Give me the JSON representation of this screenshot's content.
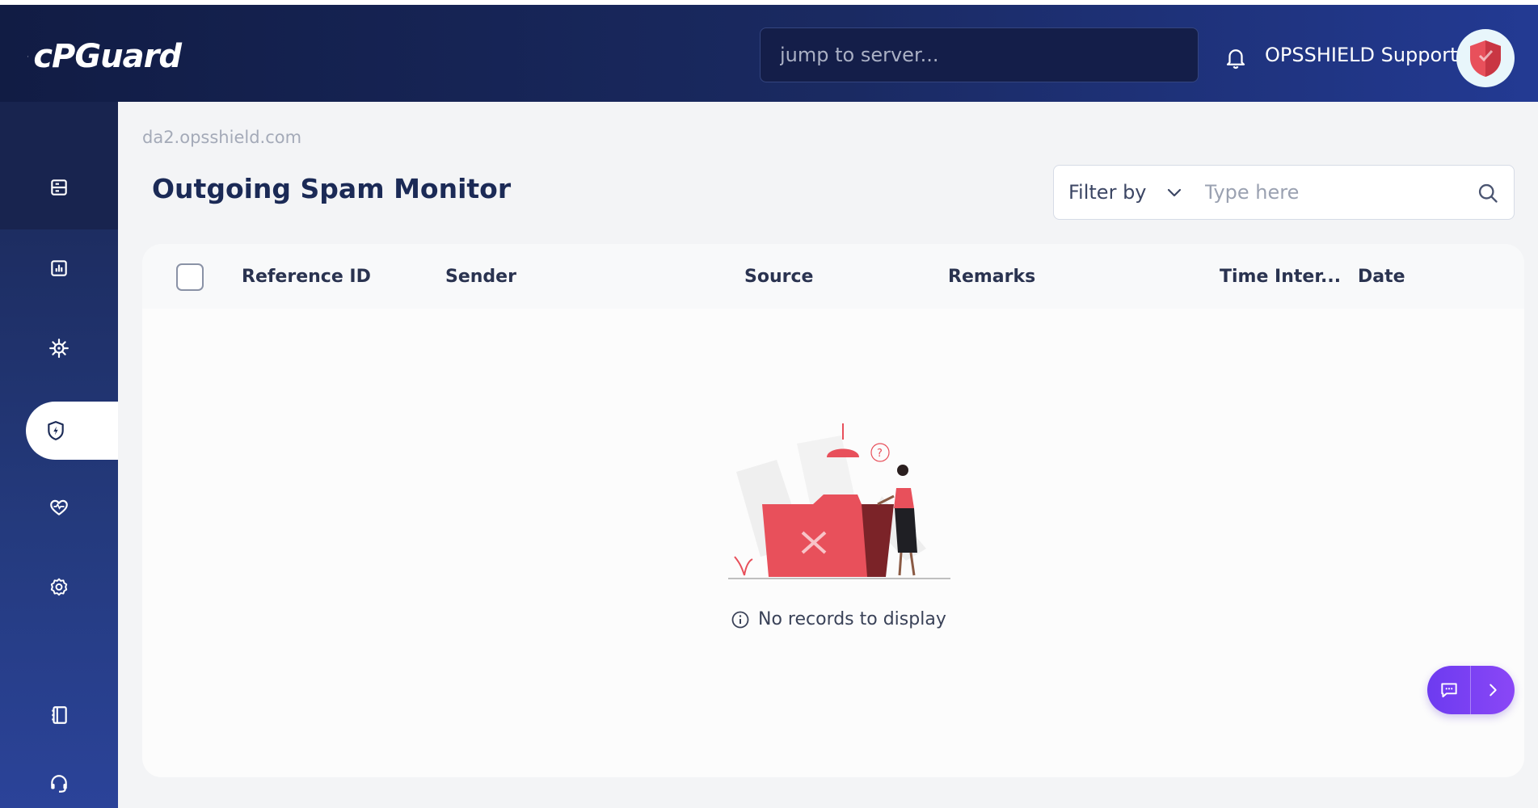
{
  "header": {
    "logo_text": "cPGuard",
    "server_search_placeholder": "jump to server...",
    "user_name": "OPSSHIELD Support"
  },
  "sidebar": {
    "items": [
      {
        "icon": "server-list-icon",
        "active": false
      },
      {
        "icon": "bar-chart-icon",
        "active": false
      },
      {
        "icon": "virus-icon",
        "active": false
      },
      {
        "icon": "shield-bolt-icon",
        "active": true
      },
      {
        "icon": "heart-pulse-icon",
        "active": false
      },
      {
        "icon": "gear-icon",
        "active": false
      },
      {
        "icon": "notebook-icon",
        "active": false
      },
      {
        "icon": "headset-icon",
        "active": false
      }
    ]
  },
  "main": {
    "breadcrumb": "da2.opsshield.com",
    "title": "Outgoing Spam Monitor",
    "filter": {
      "label": "Filter by",
      "placeholder": "Type here"
    },
    "table": {
      "columns": [
        "Reference ID",
        "Sender",
        "Source",
        "Remarks",
        "Time Inter...",
        "Date"
      ],
      "rows": []
    },
    "empty_message": "No records to display"
  },
  "colors": {
    "header_dark": "#111c44",
    "header_light": "#233a93",
    "accent_red": "#e8505b",
    "chat_purple": "#7c3ff3"
  }
}
